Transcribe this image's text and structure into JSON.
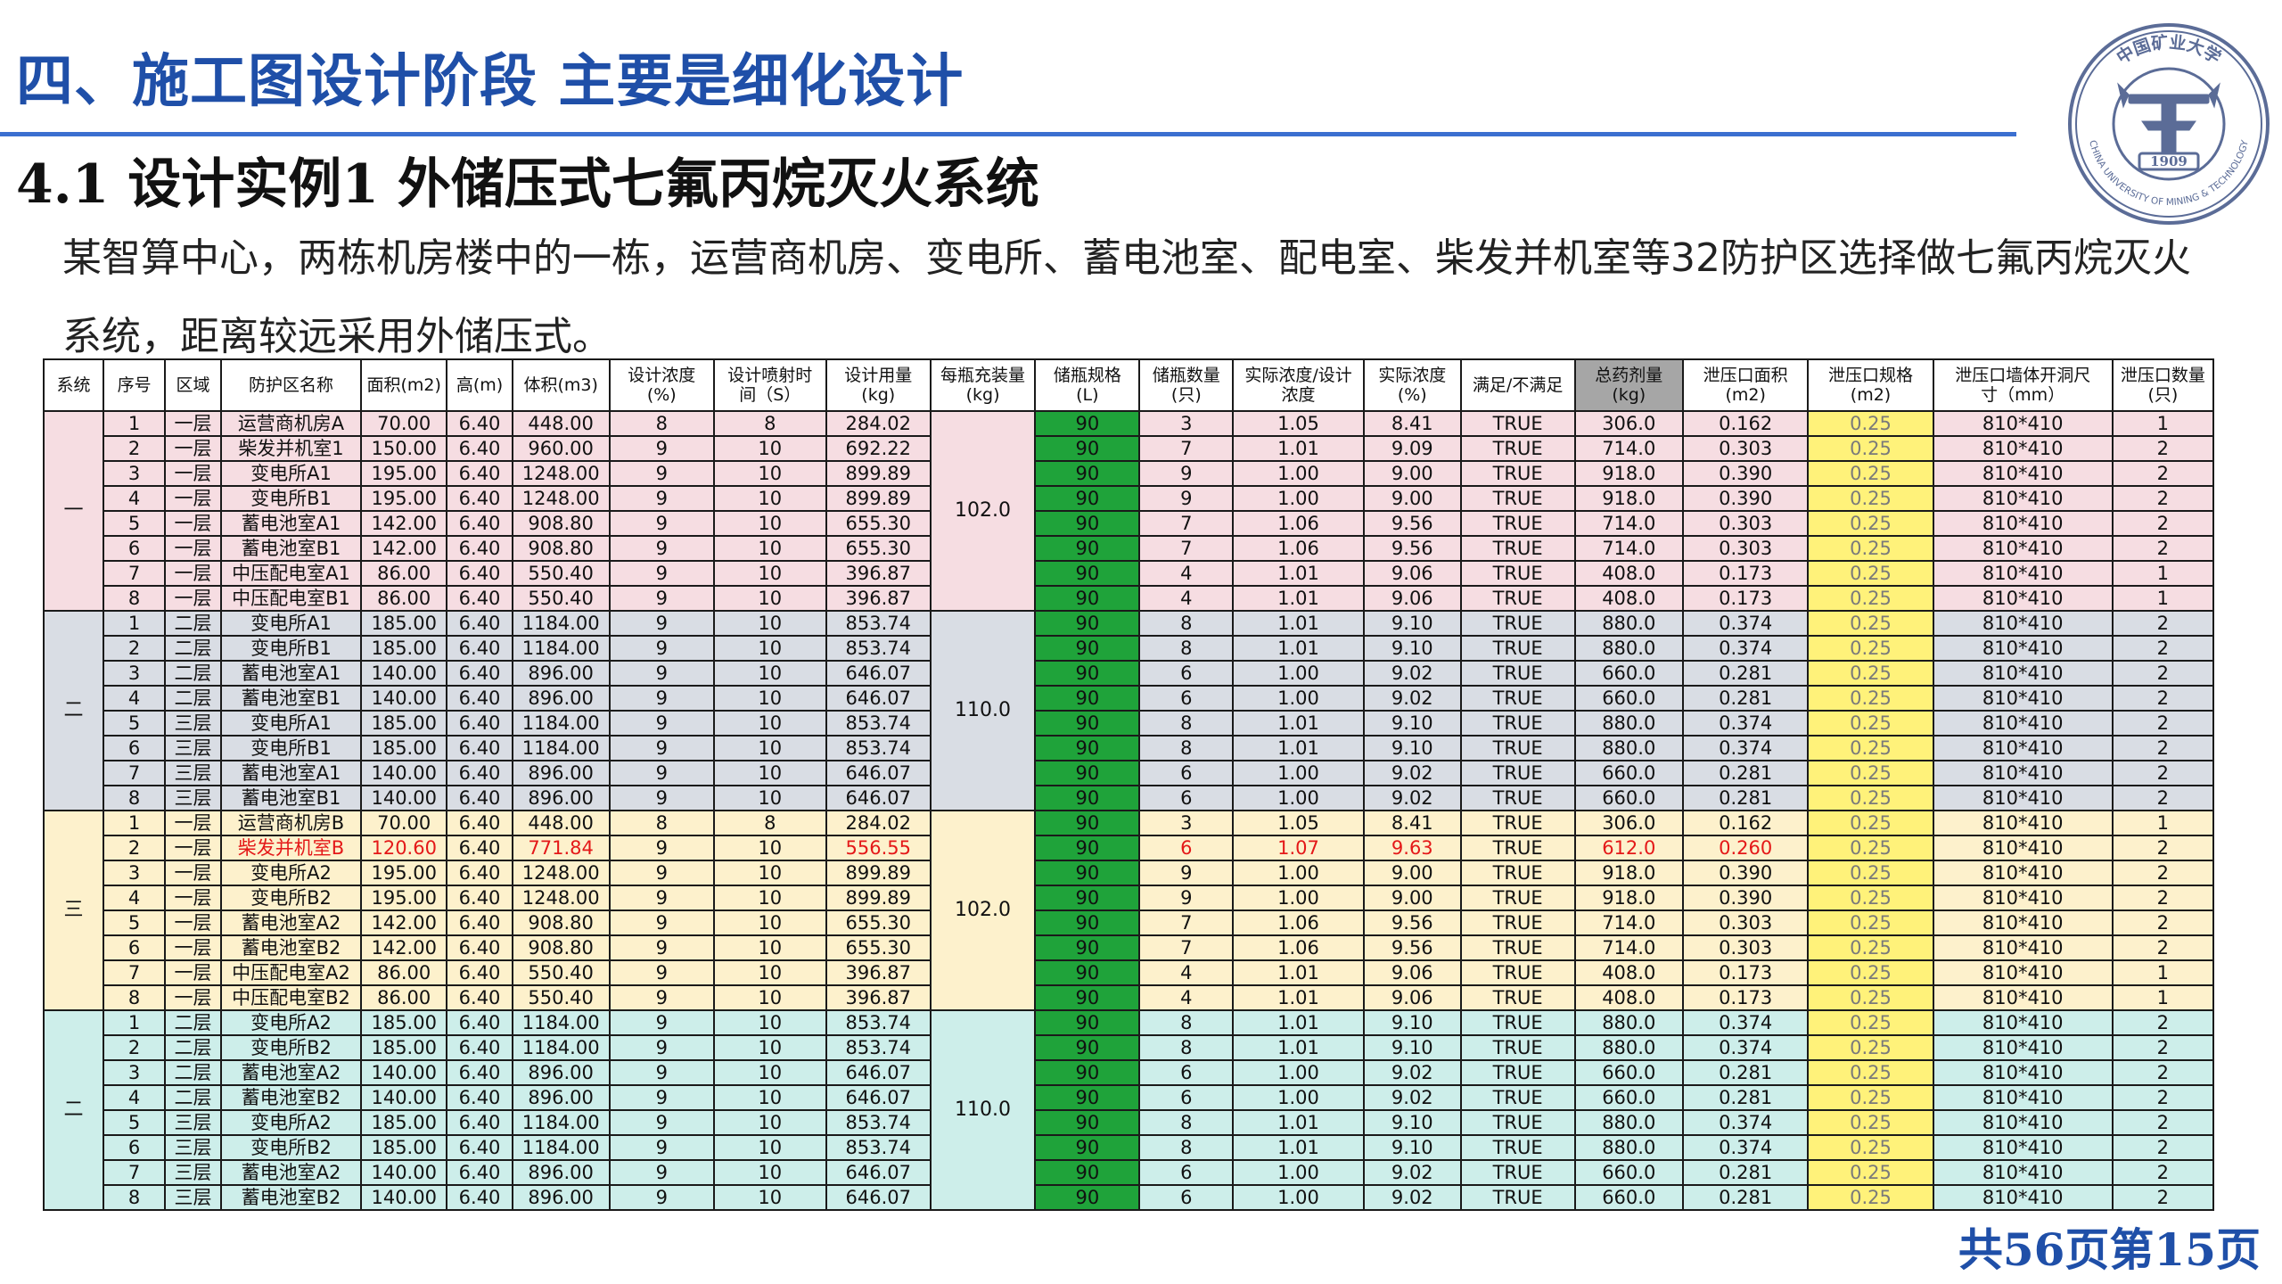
{
  "header": {
    "title": "四、施工图设计阶段 主要是细化设计",
    "subtitle": "4.1 设计实例1 外储压式七氟丙烷灭火系统",
    "description": "某智算中心，两栋机房楼中的一栋，运营商机房、变电所、蓄电池室、配电室、柴发并机室等32防护区选择做七氟丙烷灭火系统，距离较远采用外储压式。"
  },
  "logo": {
    "top_text": "中国矿业大学",
    "bottom_text": "CHINA UNIVERSITY OF MINING & TECHNOLOGY",
    "year": "1909",
    "icon": "university-seal-icon"
  },
  "colors": {
    "title": "#1f4fa8",
    "spec_cell": "#1fa33a",
    "vent_cell": "#fff27a",
    "group1": "#f6dde2",
    "group2": "#d9dde4",
    "group3": "#fdf1cc",
    "group4": "#cdeeea",
    "highlight_text": "#e41818"
  },
  "table": {
    "headers": [
      "系统",
      "序号",
      "区域",
      "防护区名称",
      "面积(m2)",
      "高(m)",
      "体积(m3)",
      "设计浓度\n(%)",
      "设计喷射时\n间（S）",
      "设计用量\n(kg)",
      "每瓶充装量\n(kg)",
      "储瓶规格\n(L)",
      "储瓶数量\n(只)",
      "实际浓度/设计\n浓度",
      "实际浓度\n(%)",
      "满足/不满足",
      "总药剂量\n(kg)",
      "泄压口面积\n(m2)",
      "泄压口规格\n(m2)",
      "泄压口墙体开洞尺\n寸（mm）",
      "泄压口数量\n(只)"
    ],
    "groups": [
      {
        "system": "一",
        "bottle_charge": "102.0",
        "rows": [
          [
            "1",
            "一层",
            "运营商机房A",
            "70.00",
            "6.40",
            "448.00",
            "8",
            "8",
            "284.02",
            "90",
            "3",
            "1.05",
            "8.41",
            "TRUE",
            "306.0",
            "0.162",
            "0.25",
            "810*410",
            "1"
          ],
          [
            "2",
            "一层",
            "柴发并机室1",
            "150.00",
            "6.40",
            "960.00",
            "9",
            "10",
            "692.22",
            "90",
            "7",
            "1.01",
            "9.09",
            "TRUE",
            "714.0",
            "0.303",
            "0.25",
            "810*410",
            "2"
          ],
          [
            "3",
            "一层",
            "变电所A1",
            "195.00",
            "6.40",
            "1248.00",
            "9",
            "10",
            "899.89",
            "90",
            "9",
            "1.00",
            "9.00",
            "TRUE",
            "918.0",
            "0.390",
            "0.25",
            "810*410",
            "2"
          ],
          [
            "4",
            "一层",
            "变电所B1",
            "195.00",
            "6.40",
            "1248.00",
            "9",
            "10",
            "899.89",
            "90",
            "9",
            "1.00",
            "9.00",
            "TRUE",
            "918.0",
            "0.390",
            "0.25",
            "810*410",
            "2"
          ],
          [
            "5",
            "一层",
            "蓄电池室A1",
            "142.00",
            "6.40",
            "908.80",
            "9",
            "10",
            "655.30",
            "90",
            "7",
            "1.06",
            "9.56",
            "TRUE",
            "714.0",
            "0.303",
            "0.25",
            "810*410",
            "2"
          ],
          [
            "6",
            "一层",
            "蓄电池室B1",
            "142.00",
            "6.40",
            "908.80",
            "9",
            "10",
            "655.30",
            "90",
            "7",
            "1.06",
            "9.56",
            "TRUE",
            "714.0",
            "0.303",
            "0.25",
            "810*410",
            "2"
          ],
          [
            "7",
            "一层",
            "中压配电室A1",
            "86.00",
            "6.40",
            "550.40",
            "9",
            "10",
            "396.87",
            "90",
            "4",
            "1.01",
            "9.06",
            "TRUE",
            "408.0",
            "0.173",
            "0.25",
            "810*410",
            "1"
          ],
          [
            "8",
            "一层",
            "中压配电室B1",
            "86.00",
            "6.40",
            "550.40",
            "9",
            "10",
            "396.87",
            "90",
            "4",
            "1.01",
            "9.06",
            "TRUE",
            "408.0",
            "0.173",
            "0.25",
            "810*410",
            "1"
          ]
        ]
      },
      {
        "system": "二",
        "bottle_charge": "110.0",
        "rows": [
          [
            "1",
            "二层",
            "变电所A1",
            "185.00",
            "6.40",
            "1184.00",
            "9",
            "10",
            "853.74",
            "90",
            "8",
            "1.01",
            "9.10",
            "TRUE",
            "880.0",
            "0.374",
            "0.25",
            "810*410",
            "2"
          ],
          [
            "2",
            "二层",
            "变电所B1",
            "185.00",
            "6.40",
            "1184.00",
            "9",
            "10",
            "853.74",
            "90",
            "8",
            "1.01",
            "9.10",
            "TRUE",
            "880.0",
            "0.374",
            "0.25",
            "810*410",
            "2"
          ],
          [
            "3",
            "二层",
            "蓄电池室A1",
            "140.00",
            "6.40",
            "896.00",
            "9",
            "10",
            "646.07",
            "90",
            "6",
            "1.00",
            "9.02",
            "TRUE",
            "660.0",
            "0.281",
            "0.25",
            "810*410",
            "2"
          ],
          [
            "4",
            "二层",
            "蓄电池室B1",
            "140.00",
            "6.40",
            "896.00",
            "9",
            "10",
            "646.07",
            "90",
            "6",
            "1.00",
            "9.02",
            "TRUE",
            "660.0",
            "0.281",
            "0.25",
            "810*410",
            "2"
          ],
          [
            "5",
            "三层",
            "变电所A1",
            "185.00",
            "6.40",
            "1184.00",
            "9",
            "10",
            "853.74",
            "90",
            "8",
            "1.01",
            "9.10",
            "TRUE",
            "880.0",
            "0.374",
            "0.25",
            "810*410",
            "2"
          ],
          [
            "6",
            "三层",
            "变电所B1",
            "185.00",
            "6.40",
            "1184.00",
            "9",
            "10",
            "853.74",
            "90",
            "8",
            "1.01",
            "9.10",
            "TRUE",
            "880.0",
            "0.374",
            "0.25",
            "810*410",
            "2"
          ],
          [
            "7",
            "三层",
            "蓄电池室A1",
            "140.00",
            "6.40",
            "896.00",
            "9",
            "10",
            "646.07",
            "90",
            "6",
            "1.00",
            "9.02",
            "TRUE",
            "660.0",
            "0.281",
            "0.25",
            "810*410",
            "2"
          ],
          [
            "8",
            "三层",
            "蓄电池室B1",
            "140.00",
            "6.40",
            "896.00",
            "9",
            "10",
            "646.07",
            "90",
            "6",
            "1.00",
            "9.02",
            "TRUE",
            "660.0",
            "0.281",
            "0.25",
            "810*410",
            "2"
          ]
        ]
      },
      {
        "system": "三",
        "bottle_charge": "102.0",
        "rows": [
          [
            "1",
            "一层",
            "运营商机房B",
            "70.00",
            "6.40",
            "448.00",
            "8",
            "8",
            "284.02",
            "90",
            "3",
            "1.05",
            "8.41",
            "TRUE",
            "306.0",
            "0.162",
            "0.25",
            "810*410",
            "1"
          ],
          [
            "2",
            "一层",
            "柴发并机室B",
            "120.60",
            "6.40",
            "771.84",
            "9",
            "10",
            "556.55",
            "90",
            "6",
            "1.07",
            "9.63",
            "TRUE",
            "612.0",
            "0.260",
            "0.25",
            "810*410",
            "2"
          ],
          [
            "3",
            "一层",
            "变电所A2",
            "195.00",
            "6.40",
            "1248.00",
            "9",
            "10",
            "899.89",
            "90",
            "9",
            "1.00",
            "9.00",
            "TRUE",
            "918.0",
            "0.390",
            "0.25",
            "810*410",
            "2"
          ],
          [
            "4",
            "一层",
            "变电所B2",
            "195.00",
            "6.40",
            "1248.00",
            "9",
            "10",
            "899.89",
            "90",
            "9",
            "1.00",
            "9.00",
            "TRUE",
            "918.0",
            "0.390",
            "0.25",
            "810*410",
            "2"
          ],
          [
            "5",
            "一层",
            "蓄电池室A2",
            "142.00",
            "6.40",
            "908.80",
            "9",
            "10",
            "655.30",
            "90",
            "7",
            "1.06",
            "9.56",
            "TRUE",
            "714.0",
            "0.303",
            "0.25",
            "810*410",
            "2"
          ],
          [
            "6",
            "一层",
            "蓄电池室B2",
            "142.00",
            "6.40",
            "908.80",
            "9",
            "10",
            "655.30",
            "90",
            "7",
            "1.06",
            "9.56",
            "TRUE",
            "714.0",
            "0.303",
            "0.25",
            "810*410",
            "2"
          ],
          [
            "7",
            "一层",
            "中压配电室A2",
            "86.00",
            "6.40",
            "550.40",
            "9",
            "10",
            "396.87",
            "90",
            "4",
            "1.01",
            "9.06",
            "TRUE",
            "408.0",
            "0.173",
            "0.25",
            "810*410",
            "1"
          ],
          [
            "8",
            "一层",
            "中压配电室B2",
            "86.00",
            "6.40",
            "550.40",
            "9",
            "10",
            "396.87",
            "90",
            "4",
            "1.01",
            "9.06",
            "TRUE",
            "408.0",
            "0.173",
            "0.25",
            "810*410",
            "1"
          ]
        ]
      },
      {
        "system": "二",
        "bottle_charge": "110.0",
        "rows": [
          [
            "1",
            "二层",
            "变电所A2",
            "185.00",
            "6.40",
            "1184.00",
            "9",
            "10",
            "853.74",
            "90",
            "8",
            "1.01",
            "9.10",
            "TRUE",
            "880.0",
            "0.374",
            "0.25",
            "810*410",
            "2"
          ],
          [
            "2",
            "二层",
            "变电所B2",
            "185.00",
            "6.40",
            "1184.00",
            "9",
            "10",
            "853.74",
            "90",
            "8",
            "1.01",
            "9.10",
            "TRUE",
            "880.0",
            "0.374",
            "0.25",
            "810*410",
            "2"
          ],
          [
            "3",
            "二层",
            "蓄电池室A2",
            "140.00",
            "6.40",
            "896.00",
            "9",
            "10",
            "646.07",
            "90",
            "6",
            "1.00",
            "9.02",
            "TRUE",
            "660.0",
            "0.281",
            "0.25",
            "810*410",
            "2"
          ],
          [
            "4",
            "二层",
            "蓄电池室B2",
            "140.00",
            "6.40",
            "896.00",
            "9",
            "10",
            "646.07",
            "90",
            "6",
            "1.00",
            "9.02",
            "TRUE",
            "660.0",
            "0.281",
            "0.25",
            "810*410",
            "2"
          ],
          [
            "5",
            "三层",
            "变电所A2",
            "185.00",
            "6.40",
            "1184.00",
            "9",
            "10",
            "853.74",
            "90",
            "8",
            "1.01",
            "9.10",
            "TRUE",
            "880.0",
            "0.374",
            "0.25",
            "810*410",
            "2"
          ],
          [
            "6",
            "三层",
            "变电所B2",
            "185.00",
            "6.40",
            "1184.00",
            "9",
            "10",
            "853.74",
            "90",
            "8",
            "1.01",
            "9.10",
            "TRUE",
            "880.0",
            "0.374",
            "0.25",
            "810*410",
            "2"
          ],
          [
            "7",
            "三层",
            "蓄电池室A2",
            "140.00",
            "6.40",
            "896.00",
            "9",
            "10",
            "646.07",
            "90",
            "6",
            "1.00",
            "9.02",
            "TRUE",
            "660.0",
            "0.281",
            "0.25",
            "810*410",
            "2"
          ],
          [
            "8",
            "三层",
            "蓄电池室B2",
            "140.00",
            "6.40",
            "896.00",
            "9",
            "10",
            "646.07",
            "90",
            "6",
            "1.00",
            "9.02",
            "TRUE",
            "660.0",
            "0.281",
            "0.25",
            "810*410",
            "2"
          ]
        ]
      }
    ],
    "highlighted_row": {
      "group": 2,
      "row": 1,
      "columns": [
        2,
        3,
        5,
        8,
        10,
        11,
        12,
        14,
        15
      ]
    }
  },
  "footer": {
    "page_label": "共56页第15页"
  }
}
